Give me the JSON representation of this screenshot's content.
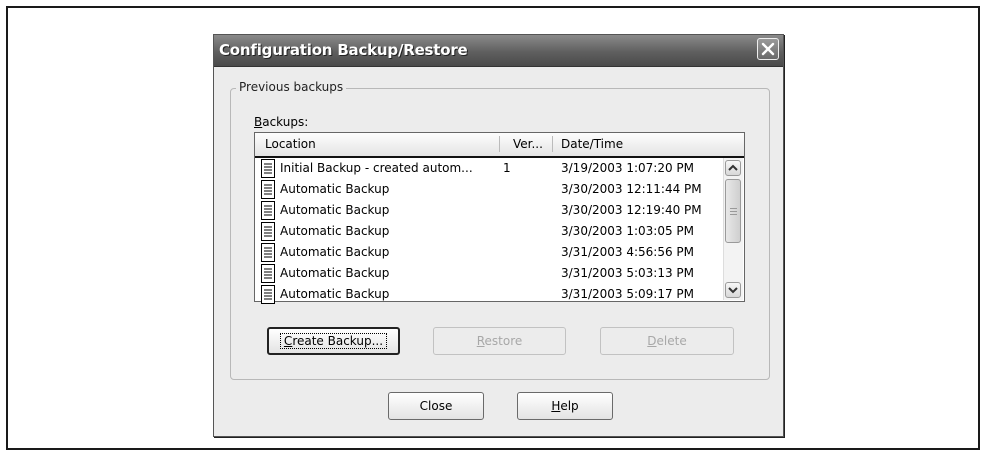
{
  "window": {
    "title": "Configuration Backup/Restore"
  },
  "group": {
    "label": "Previous backups"
  },
  "list": {
    "label_accel": "B",
    "label_rest": "ackups:",
    "columns": [
      "Location",
      "Ver...",
      "Date/Time"
    ],
    "rows": [
      {
        "location": "Initial Backup - created autom...",
        "version": "1",
        "datetime": "3/19/2003 1:07:20 PM"
      },
      {
        "location": "Automatic Backup",
        "version": "",
        "datetime": "3/30/2003 12:11:44 PM"
      },
      {
        "location": "Automatic Backup",
        "version": "",
        "datetime": "3/30/2003 12:19:40 PM"
      },
      {
        "location": "Automatic Backup",
        "version": "",
        "datetime": "3/30/2003 1:03:05 PM"
      },
      {
        "location": "Automatic Backup",
        "version": "",
        "datetime": "3/31/2003 4:56:56 PM"
      },
      {
        "location": "Automatic Backup",
        "version": "",
        "datetime": "3/31/2003 5:03:13 PM"
      },
      {
        "location": "Automatic Backup",
        "version": "",
        "datetime": "3/31/2003 5:09:17 PM"
      }
    ],
    "row_icon": "document-icon"
  },
  "buttons": {
    "create": {
      "accel": "C",
      "rest": "reate Backup..."
    },
    "restore": {
      "accel": "R",
      "rest": "estore"
    },
    "delete": {
      "accel": "D",
      "rest": "elete"
    },
    "close": {
      "label": "Close"
    },
    "help": {
      "accel": "H",
      "rest": "elp"
    }
  },
  "icons": {
    "close": "close-icon",
    "scroll_up": "scroll-up-icon",
    "scroll_down": "scroll-down-icon"
  },
  "colors": {
    "titlebar": "#5f5f5f",
    "dialog_bg": "#ececec"
  }
}
